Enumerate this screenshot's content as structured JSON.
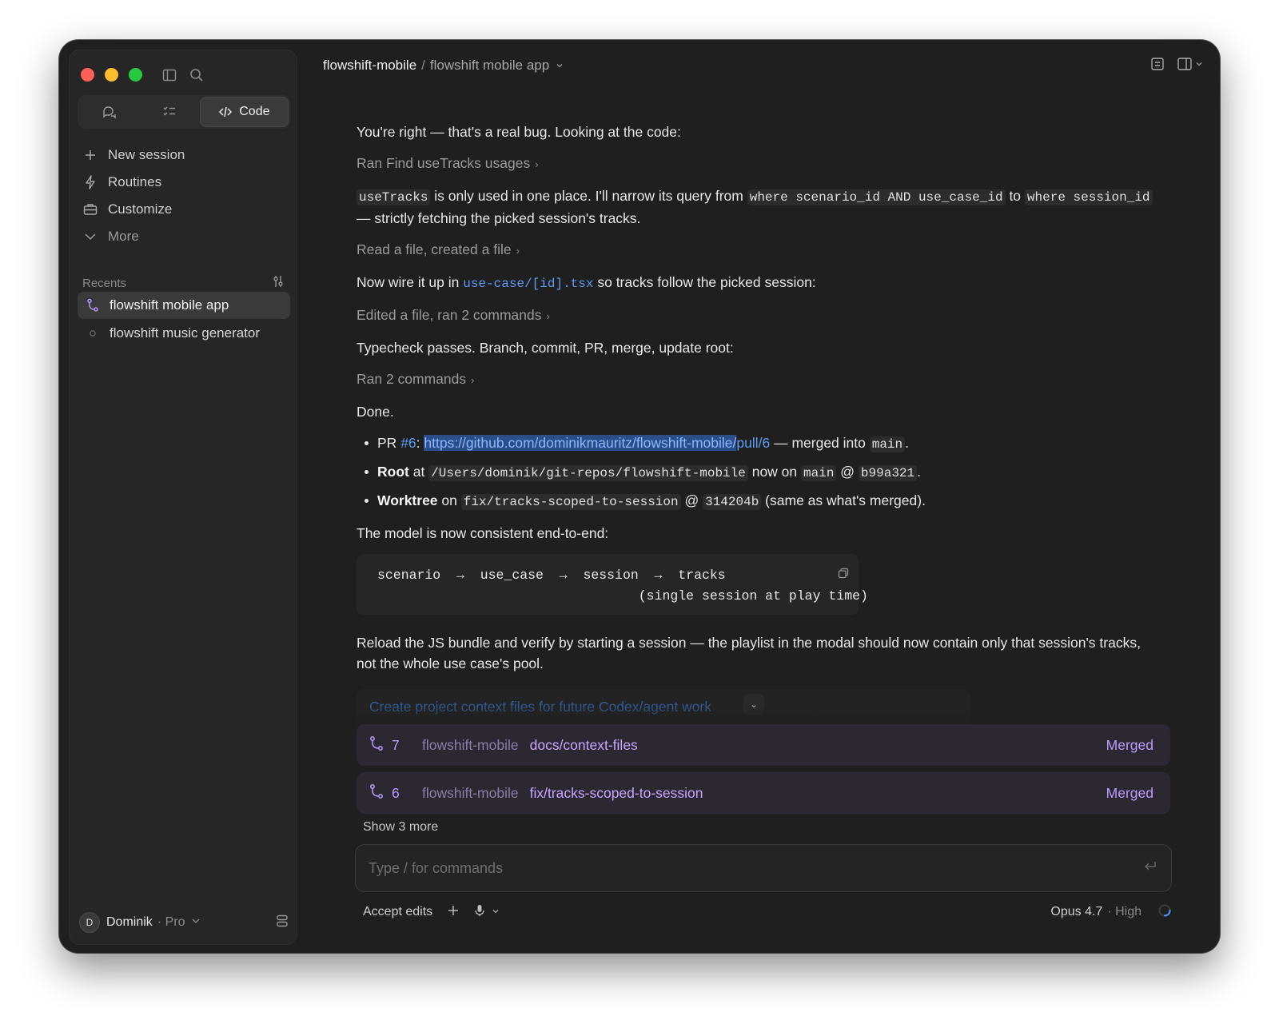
{
  "sidebar": {
    "segments": {
      "code_label": "Code"
    },
    "nav": [
      {
        "label": "New session",
        "icon": "plus-icon"
      },
      {
        "label": "Routines",
        "icon": "bolt-icon"
      },
      {
        "label": "Customize",
        "icon": "briefcase-icon"
      },
      {
        "label": "More",
        "icon": "chevron-down-icon"
      }
    ],
    "recents_label": "Recents",
    "recents": [
      {
        "label": "flowshift mobile app",
        "active": true
      },
      {
        "label": "flowshift music generator",
        "active": false
      }
    ],
    "user": {
      "initial": "D",
      "name": "Dominik",
      "tier": "· Pro"
    }
  },
  "header": {
    "project": "flowshift-mobile",
    "separator": "/",
    "session": "flowshift mobile app"
  },
  "messages": {
    "m1": "You're right — that's a real bug. Looking at the code:",
    "t1": "Ran Find useTracks usages",
    "m2": {
      "c1": "useTracks",
      "s1": " is only used in one place. I'll narrow its query from ",
      "c2": "where scenario_id AND use_case_id",
      "s2": " to ",
      "c3": "where session_id",
      "s3": " — strictly fetching the picked session's tracks."
    },
    "t2": "Read a file, created a file",
    "m3": {
      "s1": "Now wire it up in ",
      "file": "use-case/[id].tsx",
      "s2": " so tracks follow the picked session:"
    },
    "t3": "Edited a file, ran 2 commands",
    "m4": "Typecheck passes. Branch, commit, PR, merge, update root:",
    "t4": "Ran 2 commands",
    "m5": "Done.",
    "b1": {
      "s1": "PR ",
      "pr": "#6",
      "s2": ": ",
      "url_sel": "https://github.com/dominikmauritz/flowshift-mobile/",
      "url_rest": "pull/6",
      "s3": " — merged into ",
      "c1": "main",
      "s4": "."
    },
    "b2": {
      "bold": "Root",
      "s1": " at ",
      "c1": "/Users/dominik/git-repos/flowshift-mobile",
      "s2": " now on ",
      "c2": "main",
      "s3": " @ ",
      "c3": "b99a321",
      "s4": "."
    },
    "b3": {
      "bold": "Worktree",
      "s1": " on ",
      "c1": "fix/tracks-scoped-to-session",
      "s2": " @ ",
      "c2": "314204b",
      "s3": " (same as what's merged)."
    },
    "m6": "The model is now consistent end-to-end:",
    "code": "scenario  →  use_case  →  session  →  tracks\n                                 (single session at play time)",
    "m7": "Reload the JS bundle and verify by starting a session — the playlist in the modal should now contain only that session's tracks, not the whole use case's pool."
  },
  "queued_task": "Create project context files for future Codex/agent work",
  "pull_requests": [
    {
      "number": "7",
      "repo": "flowshift-mobile",
      "branch": "docs/context-files",
      "status": "Merged"
    },
    {
      "number": "6",
      "repo": "flowshift-mobile",
      "branch": "fix/tracks-scoped-to-session",
      "status": "Merged"
    }
  ],
  "show_more": "Show 3 more",
  "composer": {
    "placeholder": "Type / for commands"
  },
  "bottom": {
    "accept": "Accept edits",
    "model": "Opus 4.7",
    "effort": "· High"
  },
  "colors": {
    "accent_link": "#5b9cf5",
    "pr_accent": "#b99cff",
    "window_bg": "#1f1f1f"
  }
}
